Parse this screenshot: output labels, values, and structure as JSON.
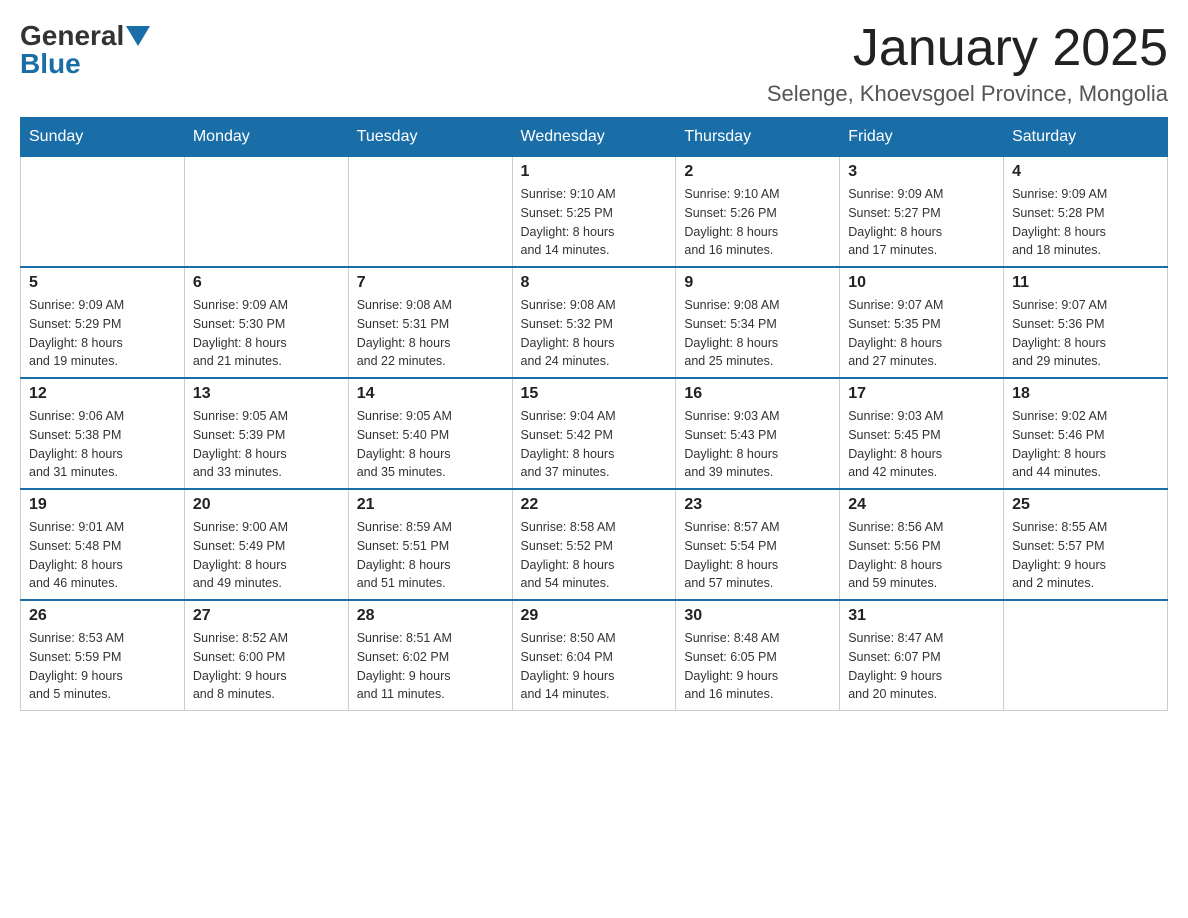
{
  "logo": {
    "general": "General",
    "blue": "Blue"
  },
  "header": {
    "month": "January 2025",
    "location": "Selenge, Khoevsgoel Province, Mongolia"
  },
  "weekdays": [
    "Sunday",
    "Monday",
    "Tuesday",
    "Wednesday",
    "Thursday",
    "Friday",
    "Saturday"
  ],
  "weeks": [
    [
      {
        "day": "",
        "info": ""
      },
      {
        "day": "",
        "info": ""
      },
      {
        "day": "",
        "info": ""
      },
      {
        "day": "1",
        "info": "Sunrise: 9:10 AM\nSunset: 5:25 PM\nDaylight: 8 hours\nand 14 minutes."
      },
      {
        "day": "2",
        "info": "Sunrise: 9:10 AM\nSunset: 5:26 PM\nDaylight: 8 hours\nand 16 minutes."
      },
      {
        "day": "3",
        "info": "Sunrise: 9:09 AM\nSunset: 5:27 PM\nDaylight: 8 hours\nand 17 minutes."
      },
      {
        "day": "4",
        "info": "Sunrise: 9:09 AM\nSunset: 5:28 PM\nDaylight: 8 hours\nand 18 minutes."
      }
    ],
    [
      {
        "day": "5",
        "info": "Sunrise: 9:09 AM\nSunset: 5:29 PM\nDaylight: 8 hours\nand 19 minutes."
      },
      {
        "day": "6",
        "info": "Sunrise: 9:09 AM\nSunset: 5:30 PM\nDaylight: 8 hours\nand 21 minutes."
      },
      {
        "day": "7",
        "info": "Sunrise: 9:08 AM\nSunset: 5:31 PM\nDaylight: 8 hours\nand 22 minutes."
      },
      {
        "day": "8",
        "info": "Sunrise: 9:08 AM\nSunset: 5:32 PM\nDaylight: 8 hours\nand 24 minutes."
      },
      {
        "day": "9",
        "info": "Sunrise: 9:08 AM\nSunset: 5:34 PM\nDaylight: 8 hours\nand 25 minutes."
      },
      {
        "day": "10",
        "info": "Sunrise: 9:07 AM\nSunset: 5:35 PM\nDaylight: 8 hours\nand 27 minutes."
      },
      {
        "day": "11",
        "info": "Sunrise: 9:07 AM\nSunset: 5:36 PM\nDaylight: 8 hours\nand 29 minutes."
      }
    ],
    [
      {
        "day": "12",
        "info": "Sunrise: 9:06 AM\nSunset: 5:38 PM\nDaylight: 8 hours\nand 31 minutes."
      },
      {
        "day": "13",
        "info": "Sunrise: 9:05 AM\nSunset: 5:39 PM\nDaylight: 8 hours\nand 33 minutes."
      },
      {
        "day": "14",
        "info": "Sunrise: 9:05 AM\nSunset: 5:40 PM\nDaylight: 8 hours\nand 35 minutes."
      },
      {
        "day": "15",
        "info": "Sunrise: 9:04 AM\nSunset: 5:42 PM\nDaylight: 8 hours\nand 37 minutes."
      },
      {
        "day": "16",
        "info": "Sunrise: 9:03 AM\nSunset: 5:43 PM\nDaylight: 8 hours\nand 39 minutes."
      },
      {
        "day": "17",
        "info": "Sunrise: 9:03 AM\nSunset: 5:45 PM\nDaylight: 8 hours\nand 42 minutes."
      },
      {
        "day": "18",
        "info": "Sunrise: 9:02 AM\nSunset: 5:46 PM\nDaylight: 8 hours\nand 44 minutes."
      }
    ],
    [
      {
        "day": "19",
        "info": "Sunrise: 9:01 AM\nSunset: 5:48 PM\nDaylight: 8 hours\nand 46 minutes."
      },
      {
        "day": "20",
        "info": "Sunrise: 9:00 AM\nSunset: 5:49 PM\nDaylight: 8 hours\nand 49 minutes."
      },
      {
        "day": "21",
        "info": "Sunrise: 8:59 AM\nSunset: 5:51 PM\nDaylight: 8 hours\nand 51 minutes."
      },
      {
        "day": "22",
        "info": "Sunrise: 8:58 AM\nSunset: 5:52 PM\nDaylight: 8 hours\nand 54 minutes."
      },
      {
        "day": "23",
        "info": "Sunrise: 8:57 AM\nSunset: 5:54 PM\nDaylight: 8 hours\nand 57 minutes."
      },
      {
        "day": "24",
        "info": "Sunrise: 8:56 AM\nSunset: 5:56 PM\nDaylight: 8 hours\nand 59 minutes."
      },
      {
        "day": "25",
        "info": "Sunrise: 8:55 AM\nSunset: 5:57 PM\nDaylight: 9 hours\nand 2 minutes."
      }
    ],
    [
      {
        "day": "26",
        "info": "Sunrise: 8:53 AM\nSunset: 5:59 PM\nDaylight: 9 hours\nand 5 minutes."
      },
      {
        "day": "27",
        "info": "Sunrise: 8:52 AM\nSunset: 6:00 PM\nDaylight: 9 hours\nand 8 minutes."
      },
      {
        "day": "28",
        "info": "Sunrise: 8:51 AM\nSunset: 6:02 PM\nDaylight: 9 hours\nand 11 minutes."
      },
      {
        "day": "29",
        "info": "Sunrise: 8:50 AM\nSunset: 6:04 PM\nDaylight: 9 hours\nand 14 minutes."
      },
      {
        "day": "30",
        "info": "Sunrise: 8:48 AM\nSunset: 6:05 PM\nDaylight: 9 hours\nand 16 minutes."
      },
      {
        "day": "31",
        "info": "Sunrise: 8:47 AM\nSunset: 6:07 PM\nDaylight: 9 hours\nand 20 minutes."
      },
      {
        "day": "",
        "info": ""
      }
    ]
  ]
}
